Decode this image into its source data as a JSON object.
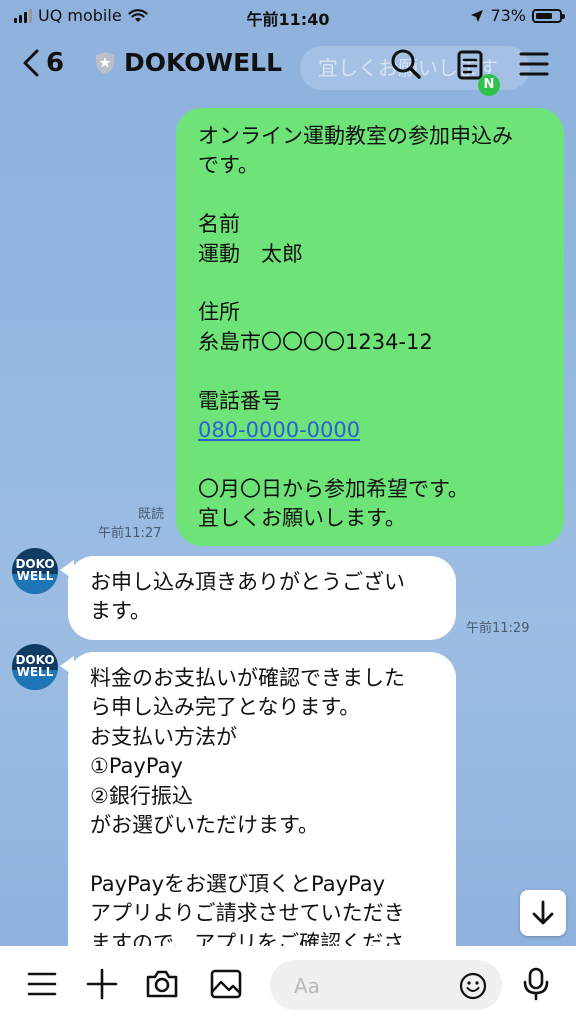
{
  "status": {
    "carrier": "UQ mobile",
    "time": "午前11:40",
    "battery": "73%",
    "battery_level": 0.73
  },
  "header": {
    "back_count": "6",
    "title": "DOKOWELL",
    "ghost_text": "宜しくお願いします",
    "notif_badge": "N"
  },
  "outgoing": {
    "lines": [
      "オンライン運動教室の参加申込み",
      "です。",
      "",
      "名前",
      "運動　太郎",
      "",
      "住所",
      "糸島市〇〇〇〇1234-12",
      "",
      "電話番号",
      "",
      "",
      "〇月〇日から参加希望です。",
      "宜しくお願いします。"
    ],
    "phone": "080-0000-0000",
    "read_label": "既読",
    "time": "午前11:27"
  },
  "avatar": {
    "line1": "DOKO",
    "line2": "WELL"
  },
  "incoming1": {
    "lines": [
      "お申し込み頂きありがとうござい",
      "ます。"
    ],
    "time": "午前11:29"
  },
  "incoming2": {
    "lines": [
      "料金のお支払いが確認できました",
      "ら申し込み完了となります。",
      "お支払い方法が",
      "①PayPay",
      "②銀行振込",
      "がお選びいただけます。",
      "",
      "PayPayをお選び頂くとPayPay",
      "アプリよりご請求させていただき",
      "ますので、アプリをご確認くださ"
    ]
  },
  "footer": {
    "input_placeholder": "Aa"
  },
  "colors": {
    "bubble_out": "#6de378",
    "bubble_in": "#ffffff",
    "link": "#2a60d8",
    "badge": "#2fc24a"
  }
}
